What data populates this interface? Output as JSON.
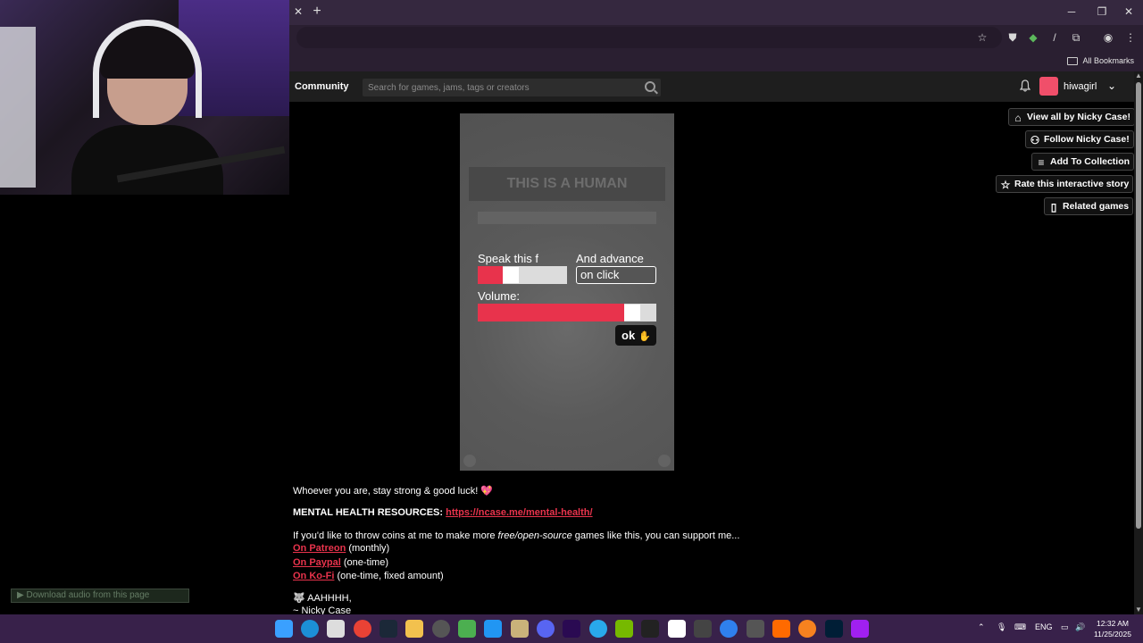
{
  "itch": {
    "community": "Community",
    "search_placeholder": "Search for games, jams, tags or creators",
    "username": "hiwagirl"
  },
  "browser": {
    "all_bookmarks": "All Bookmarks"
  },
  "actions": {
    "view_all": "View all by Nicky Case!",
    "follow": "Follow Nicky Case!",
    "add_collection": "Add To Collection",
    "rate": "Rate this interactive story",
    "related": "Related games"
  },
  "game": {
    "banner": "THIS IS A HUMAN",
    "speak_label": "Speak this f",
    "advance_label": "And advance",
    "advance_value": "on click",
    "volume_label": "Volume:",
    "ok_label": "ok",
    "speak_speed": 0.34,
    "volume": 0.9
  },
  "description": {
    "line1": "Whoever you are, stay strong & good luck!",
    "mh_label": "MENTAL HEALTH RESOURCES:",
    "mh_link": "https://ncase.me/mental-health/",
    "coins_pre": "If you'd like to throw coins at me to make more ",
    "coins_em": "free/open-source",
    "coins_post": " games like this, you can support me...",
    "patreon_link": "On Patreon",
    "patreon_note": " (monthly)",
    "paypal_link": "On Paypal",
    "paypal_note": " (one-time)",
    "kofi_link": "On Ko-Fi",
    "kofi_note": " (one-time, fixed amount)",
    "sign1": "AAHHHH,",
    "sign2": "~ Nicky Case"
  },
  "download_audio": "Download audio from this page",
  "taskbar": {
    "lang": "ENG",
    "time": "12:32 AM",
    "date": "11/25/2025"
  }
}
